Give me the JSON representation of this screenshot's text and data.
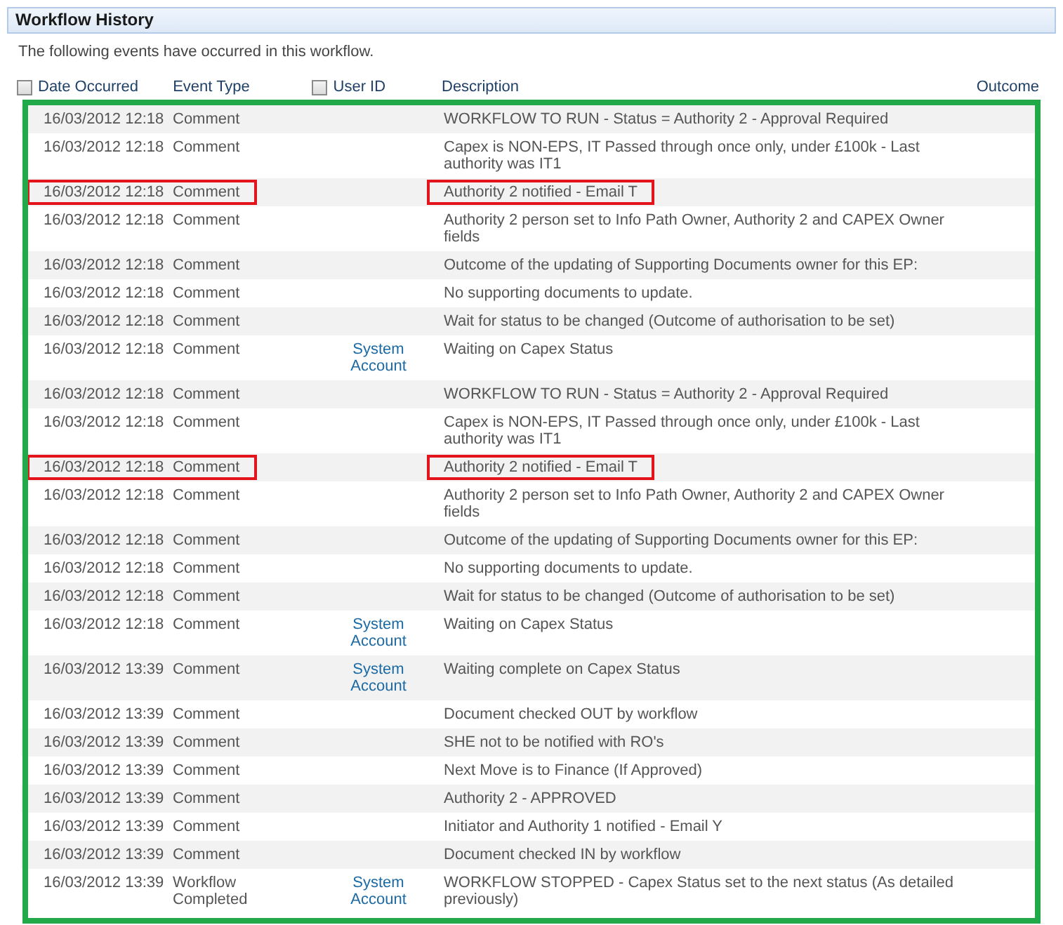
{
  "panel": {
    "title": "Workflow History",
    "intro": "The following events have occurred in this workflow."
  },
  "columns": [
    {
      "label": "Date Occurred",
      "checkbox": true,
      "checked": false
    },
    {
      "label": "Event Type",
      "checkbox": false
    },
    {
      "label": "User ID",
      "checkbox": true,
      "checked": false
    },
    {
      "label": "Description",
      "checkbox": false
    },
    {
      "label": "Outcome",
      "checkbox": false
    }
  ],
  "rows": [
    {
      "date": "16/03/2012 12:18",
      "event": "Comment",
      "user": "",
      "description": "WORKFLOW TO RUN - Status = Authority 2 - Approval Required",
      "highlighted": false
    },
    {
      "date": "16/03/2012 12:18",
      "event": "Comment",
      "user": "",
      "description": "Capex is NON-EPS, IT Passed through once only, under £100k - Last authority was IT1",
      "highlighted": false
    },
    {
      "date": "16/03/2012 12:18",
      "event": "Comment",
      "user": "",
      "description": "Authority 2 notified - Email T",
      "highlighted": true
    },
    {
      "date": "16/03/2012 12:18",
      "event": "Comment",
      "user": "",
      "description": "Authority 2 person set to Info Path Owner, Authority 2 and CAPEX Owner fields",
      "highlighted": false
    },
    {
      "date": "16/03/2012 12:18",
      "event": "Comment",
      "user": "",
      "description": "Outcome of the updating of Supporting Documents owner for this EP:",
      "highlighted": false
    },
    {
      "date": "16/03/2012 12:18",
      "event": "Comment",
      "user": "",
      "description": "No supporting documents to update.",
      "highlighted": false
    },
    {
      "date": "16/03/2012 12:18",
      "event": "Comment",
      "user": "",
      "description": "Wait for status to be changed (Outcome of authorisation to be set)",
      "highlighted": false
    },
    {
      "date": "16/03/2012 12:18",
      "event": "Comment",
      "user": "System Account",
      "description": "Waiting on Capex Status",
      "highlighted": false
    },
    {
      "date": "16/03/2012 12:18",
      "event": "Comment",
      "user": "",
      "description": "WORKFLOW TO RUN - Status = Authority 2 - Approval Required",
      "highlighted": false
    },
    {
      "date": "16/03/2012 12:18",
      "event": "Comment",
      "user": "",
      "description": "Capex is NON-EPS, IT Passed through once only, under £100k - Last authority was IT1",
      "highlighted": false
    },
    {
      "date": "16/03/2012 12:18",
      "event": "Comment",
      "user": "",
      "description": "Authority 2 notified - Email T",
      "highlighted": true
    },
    {
      "date": "16/03/2012 12:18",
      "event": "Comment",
      "user": "",
      "description": "Authority 2 person set to Info Path Owner, Authority 2 and CAPEX Owner fields",
      "highlighted": false
    },
    {
      "date": "16/03/2012 12:18",
      "event": "Comment",
      "user": "",
      "description": "Outcome of the updating of Supporting Documents owner for this EP:",
      "highlighted": false
    },
    {
      "date": "16/03/2012 12:18",
      "event": "Comment",
      "user": "",
      "description": "No supporting documents to update.",
      "highlighted": false
    },
    {
      "date": "16/03/2012 12:18",
      "event": "Comment",
      "user": "",
      "description": "Wait for status to be changed (Outcome of authorisation to be set)",
      "highlighted": false
    },
    {
      "date": "16/03/2012 12:18",
      "event": "Comment",
      "user": "System Account",
      "description": "Waiting on Capex Status",
      "highlighted": false
    },
    {
      "date": "16/03/2012 13:39",
      "event": "Comment",
      "user": "System Account",
      "description": "Waiting complete on Capex Status",
      "highlighted": false
    },
    {
      "date": "16/03/2012 13:39",
      "event": "Comment",
      "user": "",
      "description": "Document checked OUT by workflow",
      "highlighted": false
    },
    {
      "date": "16/03/2012 13:39",
      "event": "Comment",
      "user": "",
      "description": "SHE not to be notified with RO's",
      "highlighted": false
    },
    {
      "date": "16/03/2012 13:39",
      "event": "Comment",
      "user": "",
      "description": "Next Move is to Finance (If Approved)",
      "highlighted": false
    },
    {
      "date": "16/03/2012 13:39",
      "event": "Comment",
      "user": "",
      "description": "Authority 2 - APPROVED",
      "highlighted": false
    },
    {
      "date": "16/03/2012 13:39",
      "event": "Comment",
      "user": "",
      "description": "Initiator and Authority 1 notified - Email Y",
      "highlighted": false
    },
    {
      "date": "16/03/2012 13:39",
      "event": "Comment",
      "user": "",
      "description": "Document checked IN by workflow",
      "highlighted": false
    },
    {
      "date": "16/03/2012 13:39",
      "event": "Workflow Completed",
      "user": "System Account",
      "description": "WORKFLOW STOPPED - Capex Status set to the next status (As detailed previously)",
      "highlighted": false
    }
  ]
}
